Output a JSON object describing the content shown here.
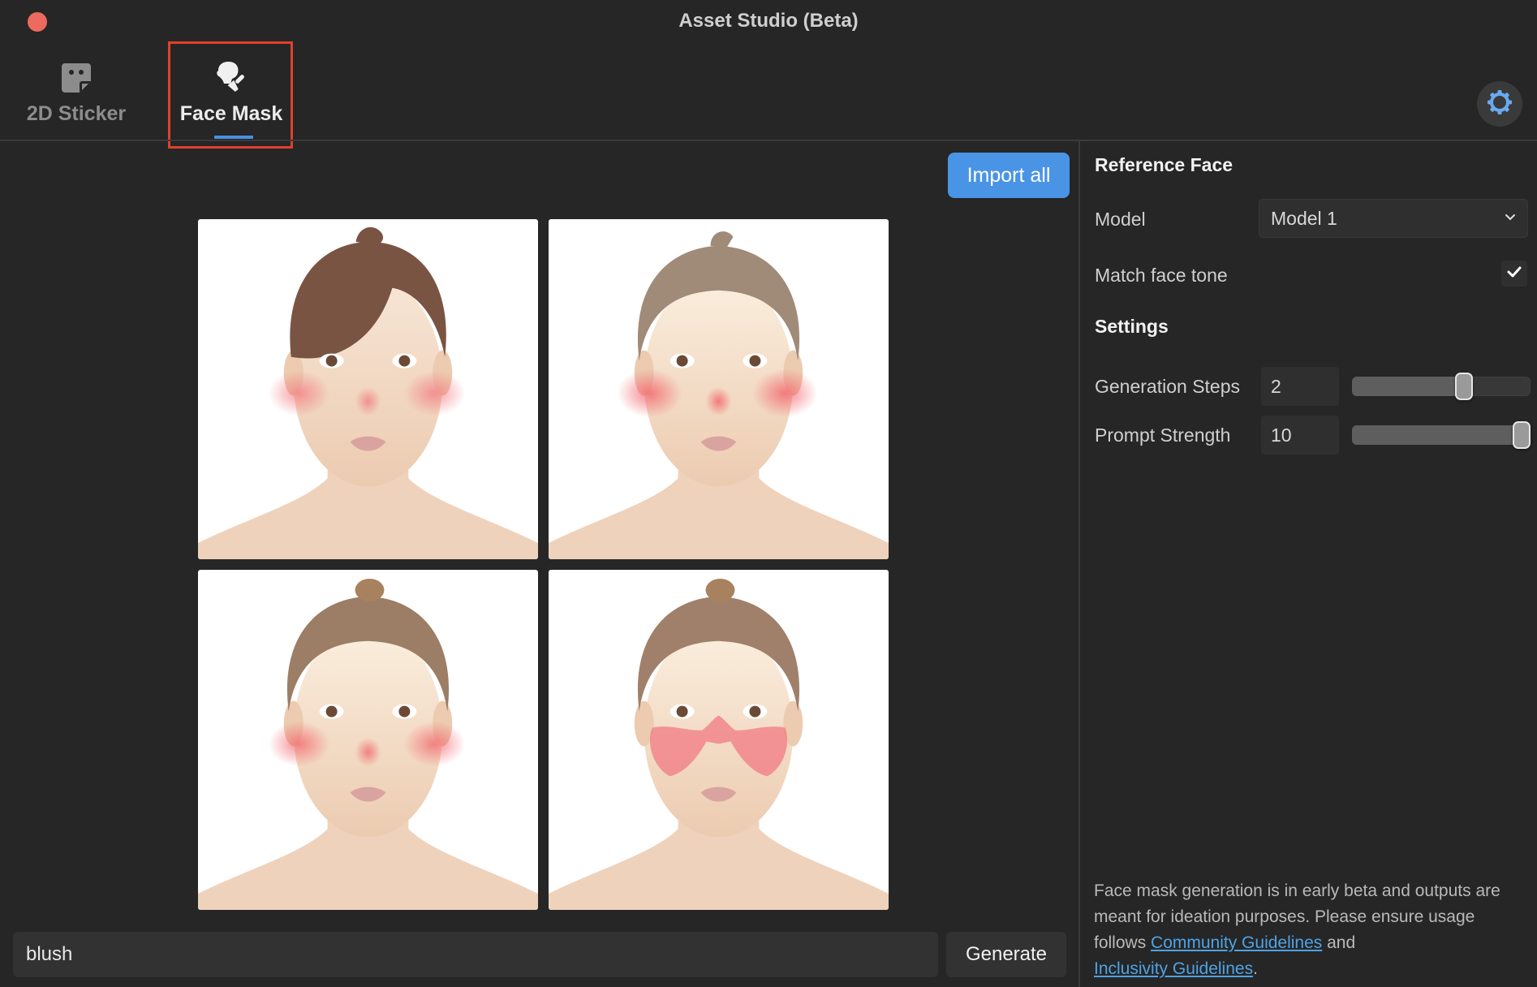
{
  "window": {
    "title": "Asset Studio (Beta)",
    "close_color": "#ec6a5e"
  },
  "tabs": [
    {
      "label": "2D Sticker",
      "icon": "sticker-icon",
      "active": false
    },
    {
      "label": "Face Mask",
      "icon": "face-mask-brush-icon",
      "active": true
    }
  ],
  "colors": {
    "accent": "#4a94e6",
    "highlight_box": "#e0402b",
    "link": "#4ea3e6",
    "background": "#262626"
  },
  "settings_button": {
    "icon": "gear-icon"
  },
  "main": {
    "import_all_label": "Import all",
    "results": [
      {
        "description": "Face with brown hair in a bun and side-swept bangs, soft pink blush on cheeks and nose"
      },
      {
        "description": "Face with slicked-back light brown hair, bright pink blush on cheeks and nose"
      },
      {
        "description": "Face with hair in a top bun, speckled pink blush on cheeks and nose"
      },
      {
        "description": "Face with hair in a top bun, textured butterfly-shaped pink blush across cheeks and nose bridge"
      }
    ],
    "prompt": {
      "value": "blush",
      "placeholder": ""
    },
    "generate_label": "Generate"
  },
  "right_panel": {
    "reference_face": {
      "heading": "Reference Face",
      "model_label": "Model",
      "model_value": "Model 1",
      "match_tone_label": "Match face tone",
      "match_tone_checked": true
    },
    "settings": {
      "heading": "Settings",
      "generation_steps": {
        "label": "Generation Steps",
        "value": "2",
        "slider_fraction": 0.64
      },
      "prompt_strength": {
        "label": "Prompt Strength",
        "value": "10",
        "slider_fraction": 1.0
      }
    },
    "disclaimer": {
      "text_before": "Face mask generation is in early beta and outputs are meant for ideation purposes. Please ensure usage follows ",
      "link1": "Community Guidelines",
      "text_middle": " and ",
      "link2": "Inclusivity Guidelines",
      "text_after": "."
    }
  }
}
